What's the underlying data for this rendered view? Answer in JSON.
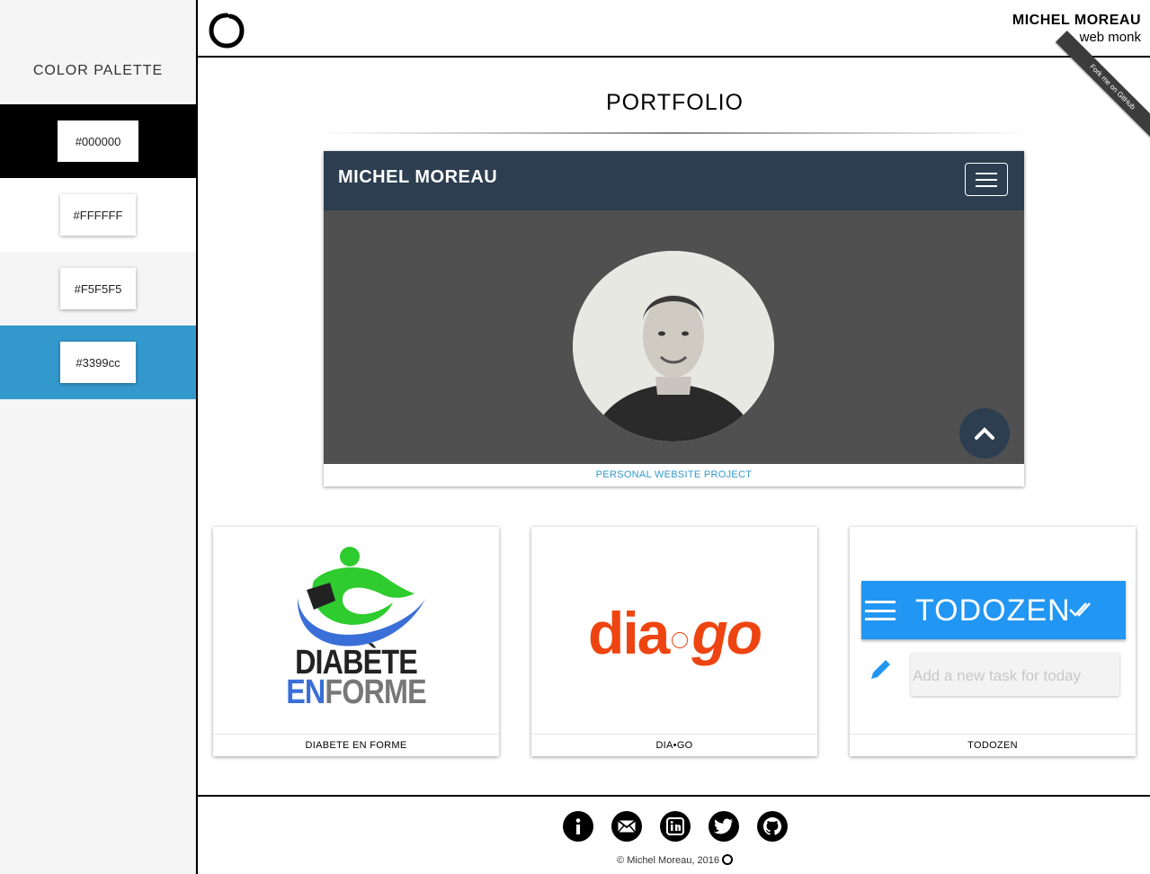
{
  "sidebar": {
    "title": "COLOR PALETTE",
    "swatches": [
      {
        "label": "#000000",
        "color": "#000000"
      },
      {
        "label": "#FFFFFF",
        "color": "#FFFFFF"
      },
      {
        "label": "#F5F5F5",
        "color": "#F5F5F5"
      },
      {
        "label": "#3399cc",
        "color": "#3399cc"
      }
    ]
  },
  "header": {
    "name": "MICHEL MOREAU",
    "tagline": "web monk",
    "ribbon": "Fork me on GitHub"
  },
  "main": {
    "title": "PORTFOLIO",
    "featured": {
      "nav_title": "MICHEL MOREAU",
      "caption": "PERSONAL WEBSITE PROJECT"
    },
    "projects": [
      {
        "caption": "DIABETE EN FORME",
        "logo_line1": "DIABÈTE",
        "logo_line2a": "EN",
        "logo_line2b": "FORME"
      },
      {
        "caption": "DIA•GO",
        "logo_a": "dia",
        "logo_b": "go"
      },
      {
        "caption": "TODOZEN",
        "app_title": "TODOZEN",
        "placeholder": "Add a new task for today"
      }
    ]
  },
  "footer": {
    "icons": [
      "info-icon",
      "mail-icon",
      "linkedin-icon",
      "twitter-icon",
      "github-icon"
    ],
    "copyright": "© Michel Moreau, 2016"
  },
  "colors": {
    "accent": "#3399cc",
    "nav": "#2c3e50",
    "todozen": "#2196f3",
    "diago": "#ee4411"
  }
}
